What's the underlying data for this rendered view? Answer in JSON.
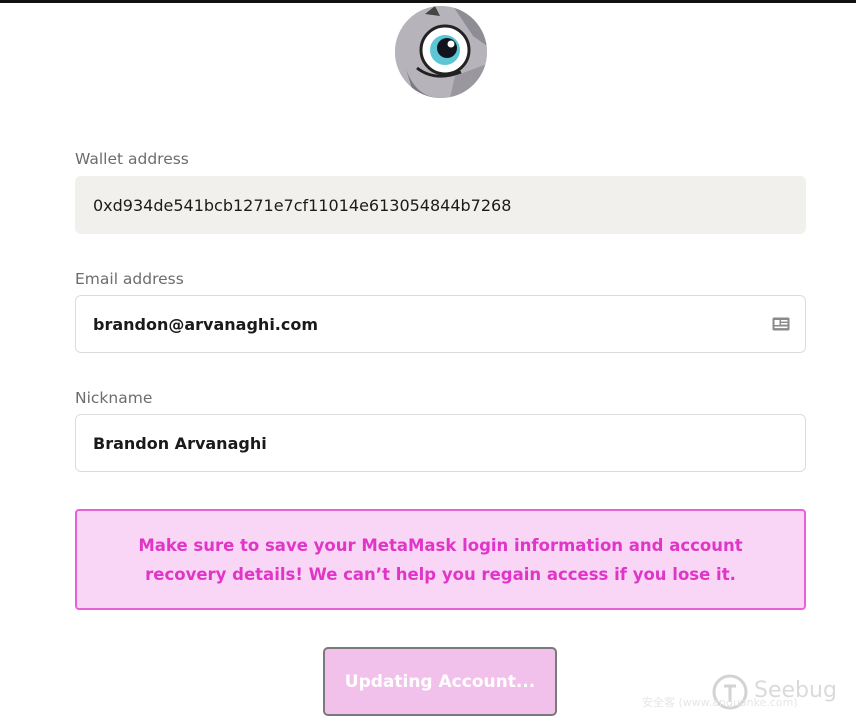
{
  "wallet": {
    "label": "Wallet address",
    "value": "0xd934de541bcb1271e7cf11014e613054844b7268"
  },
  "email": {
    "label": "Email address",
    "value": "brandon@arvanaghi.com",
    "icon": "contact-card-icon"
  },
  "nickname": {
    "label": "Nickname",
    "value": "Brandon Arvanaghi"
  },
  "notice": {
    "text": "Make sure to save your MetaMask login information and account recovery details! We can’t help you regain access if you lose it."
  },
  "button": {
    "label": "Updating Account..."
  },
  "watermark": {
    "text": "Seebug",
    "sub": "安全客 (www.anquanke.com)"
  },
  "colors": {
    "notice_text": "#df36c8",
    "notice_bg": "#f9d6f5",
    "notice_border": "#e861d6",
    "button_bg": "#f1c1ec"
  }
}
